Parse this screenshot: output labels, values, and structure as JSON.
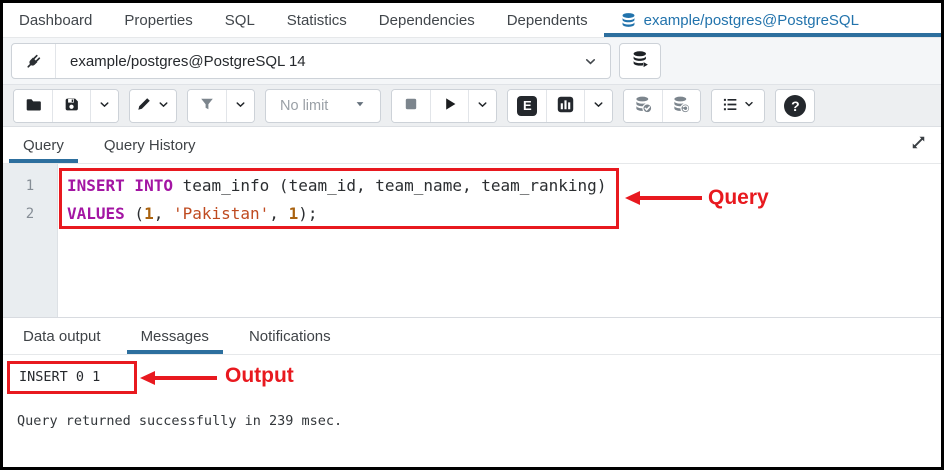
{
  "colors": {
    "accent_blue": "#2273ac",
    "annotation_red": "#e8191f",
    "sql_keyword": "#a315a3",
    "sql_number": "#a9620f",
    "sql_string": "#bf4a1f"
  },
  "header_tabs": {
    "items": [
      {
        "label": "Dashboard"
      },
      {
        "label": "Properties"
      },
      {
        "label": "SQL"
      },
      {
        "label": "Statistics"
      },
      {
        "label": "Dependencies"
      },
      {
        "label": "Dependents"
      }
    ],
    "active": {
      "label": "example/postgres@PostgreSQL"
    }
  },
  "connection_bar": {
    "selected": "example/postgres@PostgreSQL 14"
  },
  "toolbar": {
    "limit_label": "No limit"
  },
  "icons": {
    "explain_badge": "E",
    "help_glyph": "?"
  },
  "editor_tabs": {
    "items": [
      {
        "label": "Query",
        "active": true
      },
      {
        "label": "Query History",
        "active": false
      }
    ]
  },
  "editor": {
    "lines": [
      {
        "number": "1",
        "segments": [
          {
            "t": "keyword",
            "text": "INSERT INTO"
          },
          {
            "t": "plain",
            "text": " team_info (team_id, team_name, team_ranking)"
          }
        ]
      },
      {
        "number": "2",
        "segments": [
          {
            "t": "keyword",
            "text": "VALUES"
          },
          {
            "t": "plain",
            "text": " ("
          },
          {
            "t": "number",
            "text": "1"
          },
          {
            "t": "plain",
            "text": ", "
          },
          {
            "t": "string",
            "text": "'Pakistan'"
          },
          {
            "t": "plain",
            "text": ", "
          },
          {
            "t": "number",
            "text": "1"
          },
          {
            "t": "plain",
            "text": ");"
          }
        ]
      }
    ]
  },
  "annotations": {
    "query": "Query",
    "output": "Output"
  },
  "output_panel": {
    "tabs": [
      {
        "label": "Data output",
        "active": false
      },
      {
        "label": "Messages",
        "active": true
      },
      {
        "label": "Notifications",
        "active": false
      }
    ],
    "result": "INSERT 0 1",
    "status": "Query returned successfully in 239 msec."
  }
}
